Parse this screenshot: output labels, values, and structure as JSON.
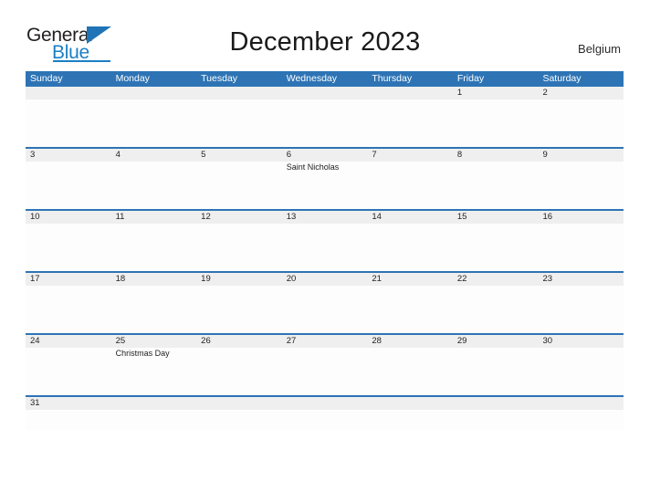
{
  "brand": {
    "name_part1": "General",
    "name_part2": "Blue",
    "flag_icon": "triangle-flag-icon",
    "colors": {
      "text_dark": "#231f20",
      "blue": "#1b7fc4"
    }
  },
  "header": {
    "title": "December 2023",
    "region": "Belgium"
  },
  "colors": {
    "header_blue": "#2e74b5",
    "row_separator_blue": "#2e74b5",
    "date_band_gray": "#efefef",
    "cell_white": "#fdfdfd"
  },
  "weekdays": [
    "Sunday",
    "Monday",
    "Tuesday",
    "Wednesday",
    "Thursday",
    "Friday",
    "Saturday"
  ],
  "weeks": [
    {
      "dates": [
        "",
        "",
        "",
        "",
        "",
        "1",
        "2"
      ],
      "events": [
        "",
        "",
        "",
        "",
        "",
        "",
        ""
      ]
    },
    {
      "dates": [
        "3",
        "4",
        "5",
        "6",
        "7",
        "8",
        "9"
      ],
      "events": [
        "",
        "",
        "",
        "Saint Nicholas",
        "",
        "",
        ""
      ]
    },
    {
      "dates": [
        "10",
        "11",
        "12",
        "13",
        "14",
        "15",
        "16"
      ],
      "events": [
        "",
        "",
        "",
        "",
        "",
        "",
        ""
      ]
    },
    {
      "dates": [
        "17",
        "18",
        "19",
        "20",
        "21",
        "22",
        "23"
      ],
      "events": [
        "",
        "",
        "",
        "",
        "",
        "",
        ""
      ]
    },
    {
      "dates": [
        "24",
        "25",
        "26",
        "27",
        "28",
        "29",
        "30"
      ],
      "events": [
        "",
        "Christmas Day",
        "",
        "",
        "",
        "",
        ""
      ]
    },
    {
      "dates": [
        "31",
        "",
        "",
        "",
        "",
        "",
        ""
      ],
      "events": [
        "",
        "",
        "",
        "",
        "",
        "",
        ""
      ]
    }
  ]
}
